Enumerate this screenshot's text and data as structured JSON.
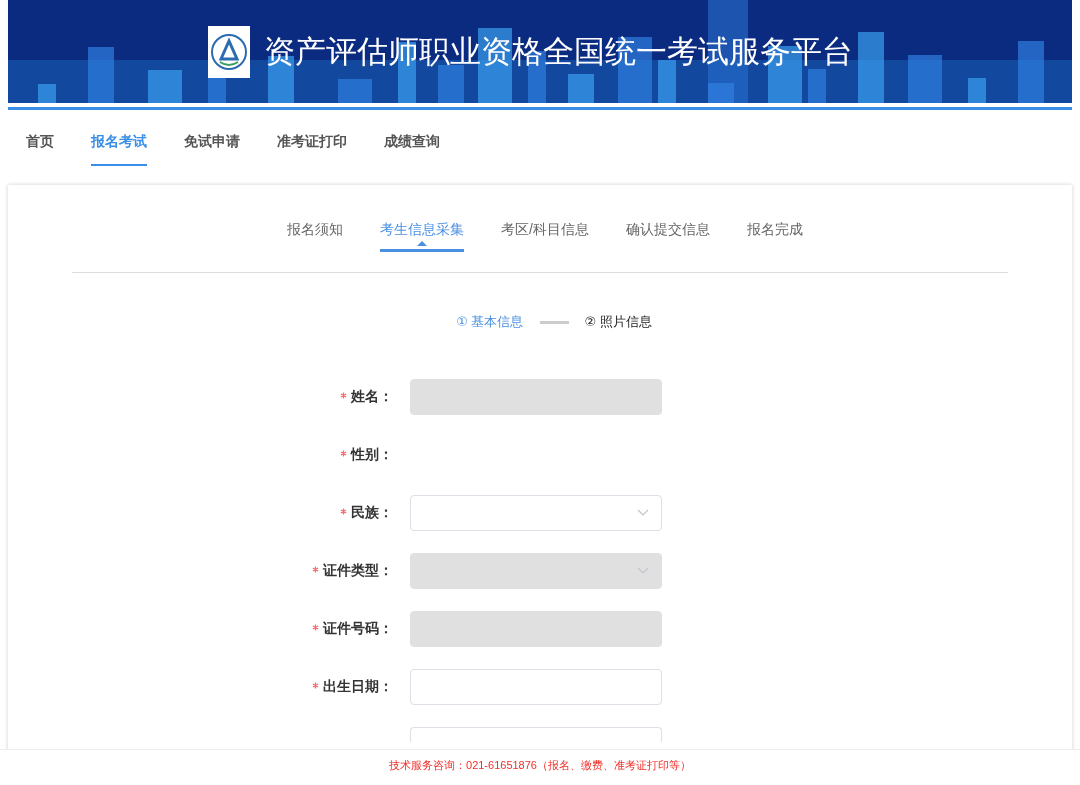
{
  "header": {
    "title": "资产评估师职业资格全国统一考试服务平台"
  },
  "nav": [
    {
      "label": "首页",
      "selected": false
    },
    {
      "label": "报名考试",
      "selected": true
    },
    {
      "label": "免试申请",
      "selected": false
    },
    {
      "label": "准考证打印",
      "selected": false
    },
    {
      "label": "成绩查询",
      "selected": false
    }
  ],
  "steps": [
    {
      "label": "报名须知",
      "selected": false
    },
    {
      "label": "考生信息采集",
      "selected": true
    },
    {
      "label": "考区/科目信息",
      "selected": false
    },
    {
      "label": "确认提交信息",
      "selected": false
    },
    {
      "label": "报名完成",
      "selected": false
    }
  ],
  "substeps": [
    {
      "label": "① 基本信息",
      "selected": true
    },
    {
      "label": "② 照片信息",
      "selected": false
    }
  ],
  "form": [
    {
      "label": "姓名：",
      "required": true,
      "kind": "text",
      "disabled": true
    },
    {
      "label": "性别：",
      "required": true,
      "kind": "none"
    },
    {
      "label": "民族：",
      "required": true,
      "kind": "select",
      "disabled": false
    },
    {
      "label": "证件类型：",
      "required": true,
      "kind": "select",
      "disabled": true
    },
    {
      "label": "证件号码：",
      "required": true,
      "kind": "text",
      "disabled": true
    },
    {
      "label": "出生日期：",
      "required": true,
      "kind": "text",
      "disabled": false
    },
    {
      "kind": "text",
      "disabled": false
    }
  ],
  "footer": {
    "text": "技术服务咨询：021-61651876（报名、缴费、准考证打印等）"
  }
}
